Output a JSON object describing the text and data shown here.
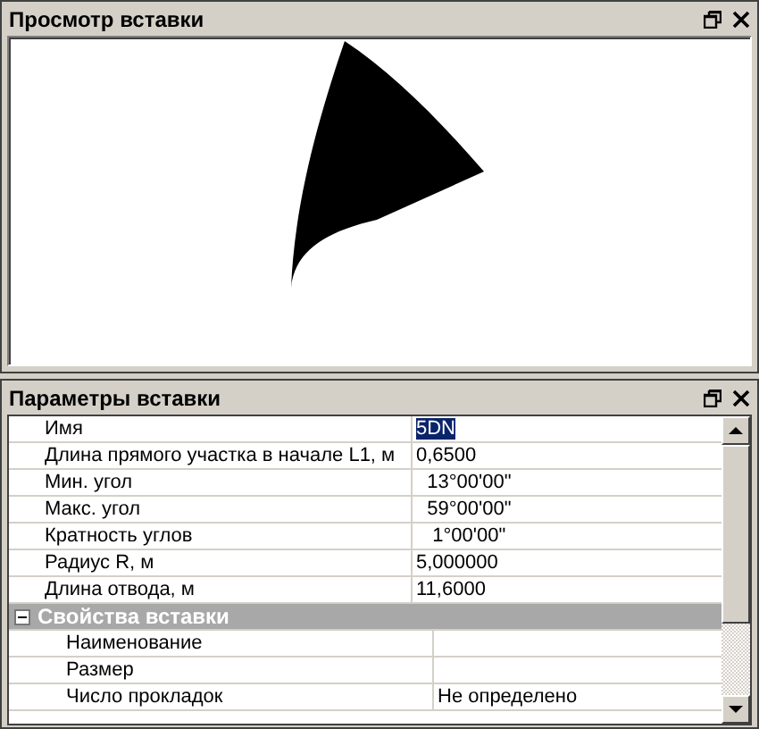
{
  "preview_panel": {
    "title": "Просмотр вставки"
  },
  "properties_panel": {
    "title": "Параметры вставки",
    "rows": [
      {
        "kind": "property",
        "label": "Имя",
        "value": "5DN",
        "selected": true
      },
      {
        "kind": "property",
        "label": "Длина прямого участка в начале L1, м",
        "value": "0,6500",
        "selected": false
      },
      {
        "kind": "property",
        "label": "Мин. угол",
        "value": "  13°00'00\"",
        "selected": false
      },
      {
        "kind": "property",
        "label": "Макс. угол",
        "value": "  59°00'00\"",
        "selected": false
      },
      {
        "kind": "property",
        "label": "Кратность углов",
        "value": "   1°00'00\"",
        "selected": false
      },
      {
        "kind": "property",
        "label": "Радиус R, м",
        "value": "5,000000",
        "selected": false
      },
      {
        "kind": "property",
        "label": "Длина отвода, м",
        "value": "11,6000",
        "selected": false
      },
      {
        "kind": "category",
        "label": "Свойства вставки",
        "expanded": true,
        "children": [
          {
            "kind": "property",
            "label": "Наименование",
            "selected": false
          },
          {
            "kind": "property",
            "label": "Размер",
            "selected": false
          },
          {
            "kind": "property",
            "label": "Число прокладок",
            "value": "Не определено",
            "selected": false
          }
        ]
      }
    ]
  }
}
